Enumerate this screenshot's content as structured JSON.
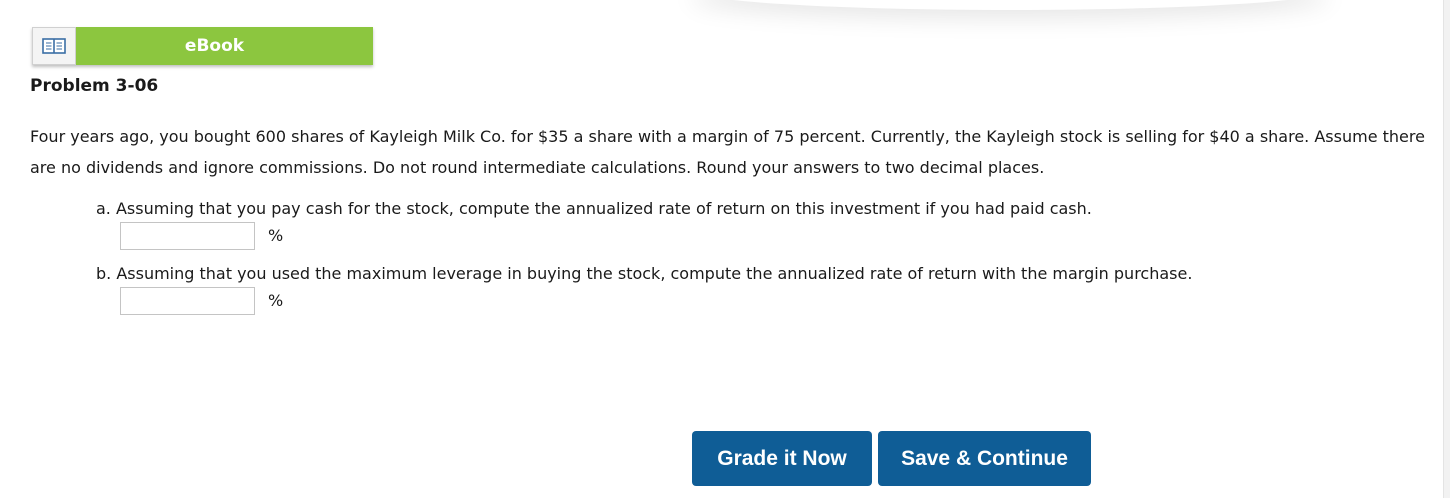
{
  "ebook": {
    "label": "eBook",
    "icon": "open-book-icon"
  },
  "problem": {
    "title": "Problem 3-06",
    "text": "Four years ago, you bought 600 shares of Kayleigh Milk Co. for $35 a share with a margin of 75 percent. Currently, the Kayleigh stock is selling for $40 a share. Assume there are no dividends and ignore commissions. Do not round intermediate calculations. Round your answers to two decimal places."
  },
  "questions": [
    {
      "text": "a. Assuming that you pay cash for the stock, compute the annualized rate of return on this investment if you had paid cash.",
      "value": "",
      "unit": "%"
    },
    {
      "text": "b. Assuming that you used the maximum leverage in buying the stock, compute the annualized rate of return with the margin purchase.",
      "value": "",
      "unit": "%"
    }
  ],
  "buttons": {
    "grade": "Grade it Now",
    "save": "Save & Continue"
  },
  "colors": {
    "ebook_green": "#8cc63f",
    "button_blue": "#0f5d96"
  }
}
